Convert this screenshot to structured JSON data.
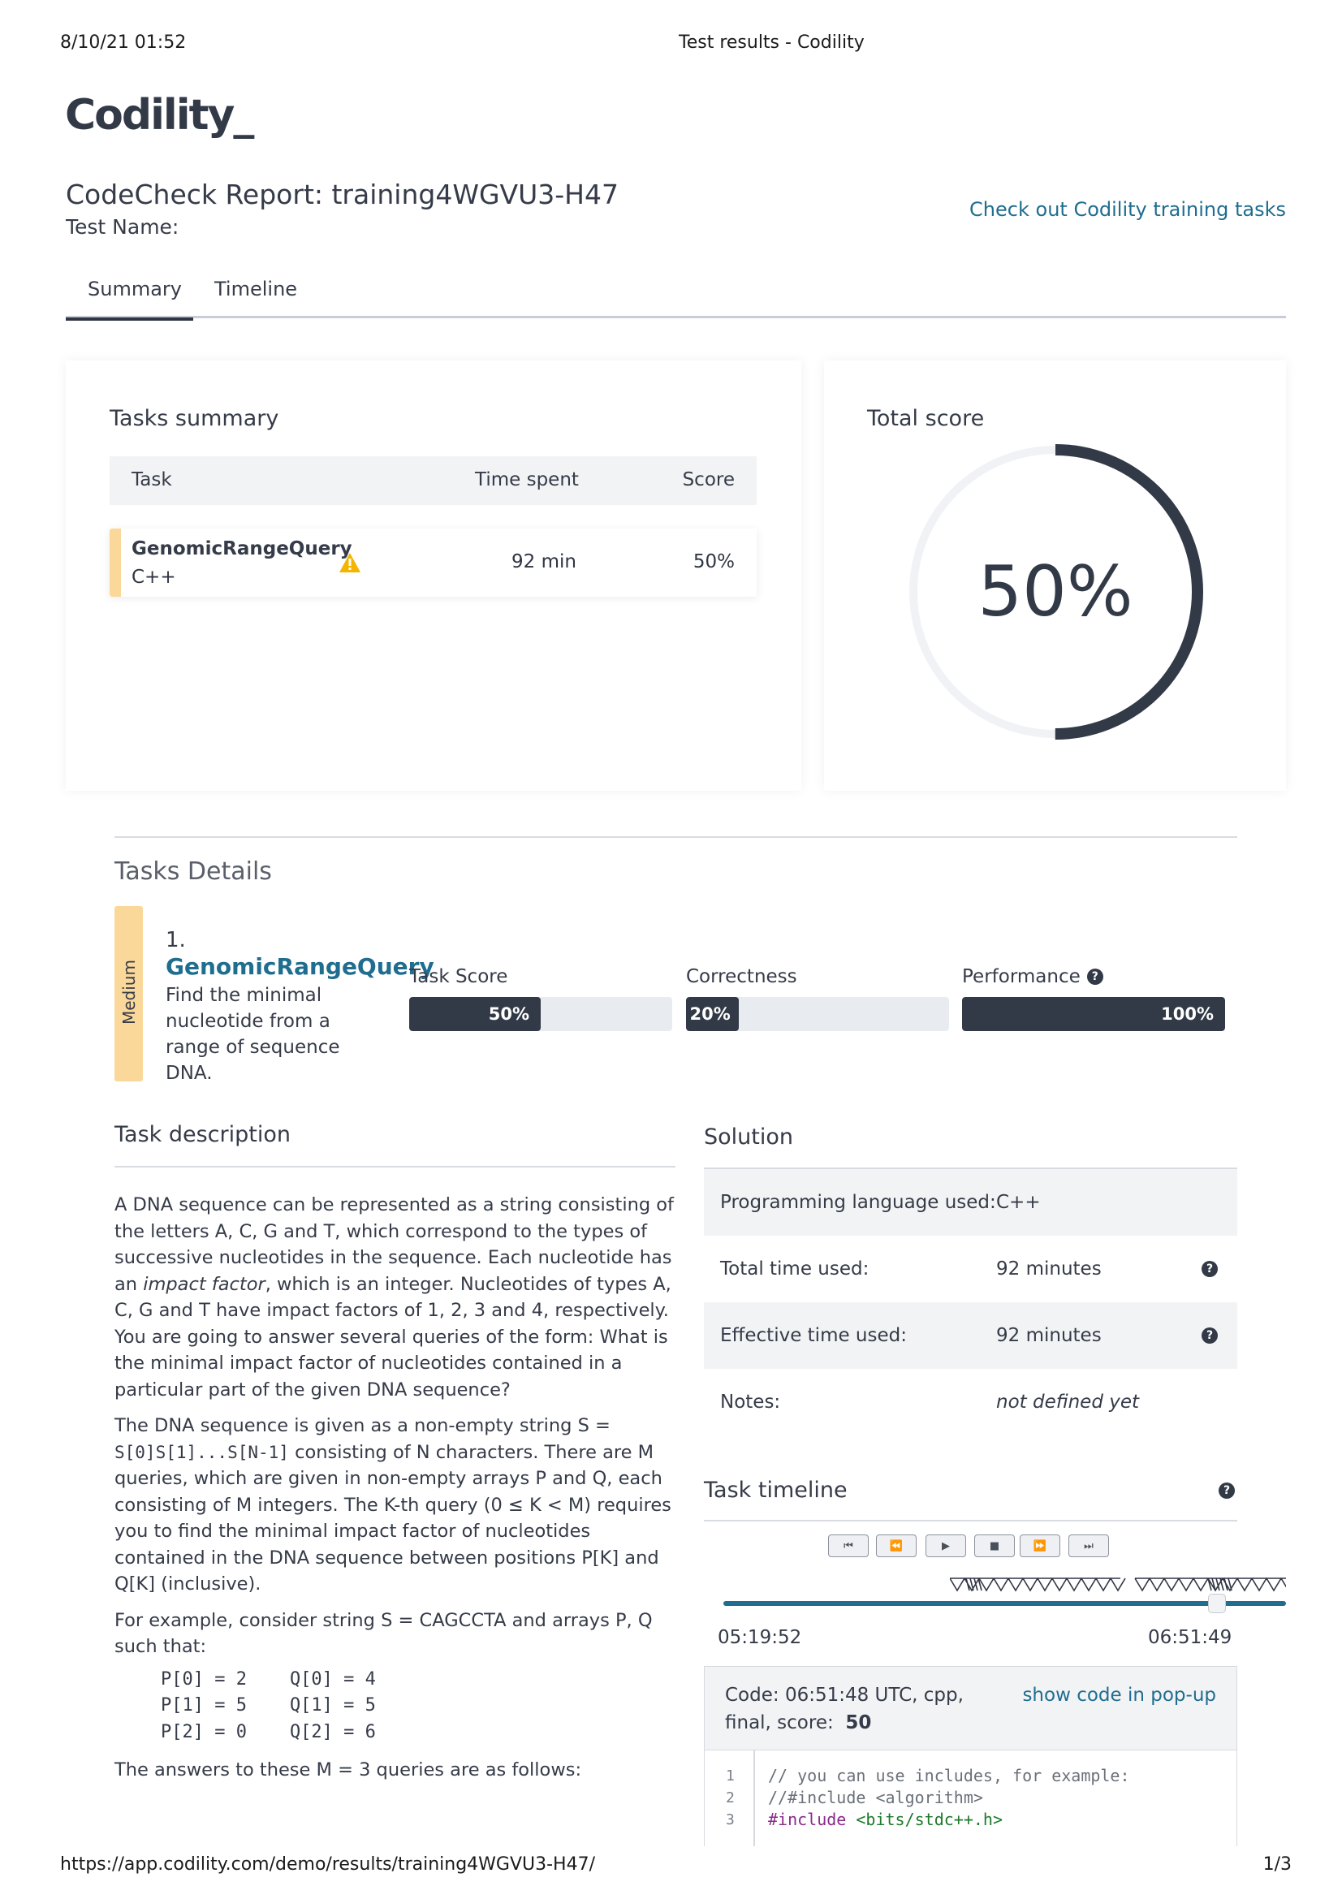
{
  "print_header": {
    "datetime": "8/10/21 01:52",
    "page_title": "Test results - Codility"
  },
  "brand": {
    "logo": "Codility_"
  },
  "report": {
    "title": "CodeCheck Report: training4WGVU3-H47",
    "test_name_label": "Test Name:",
    "training_link": "Check out Codility training tasks"
  },
  "tabs": [
    {
      "label": "Summary",
      "active": true
    },
    {
      "label": "Timeline",
      "active": false
    }
  ],
  "tasks_summary": {
    "title": "Tasks summary",
    "headers": {
      "task": "Task",
      "time": "Time spent",
      "score": "Score"
    },
    "rows": [
      {
        "name": "GenomicRangeQuery",
        "lang": "C++",
        "time": "92 min",
        "score": "50%",
        "warning": "warning-icon"
      }
    ]
  },
  "total_score": {
    "title": "Total score",
    "value": "50%",
    "fraction": 0.5
  },
  "tasks_details": {
    "title": "Tasks Details",
    "difficulty": "Medium",
    "number": "1.",
    "task_name": "GenomicRangeQuery",
    "task_summary": "Find the minimal nucleotide from a range of sequence DNA.",
    "metrics": [
      {
        "label": "Task Score",
        "value": "50%",
        "fraction": 0.5
      },
      {
        "label": "Correctness",
        "value": "20%",
        "fraction": 0.2
      },
      {
        "label": "Performance",
        "value": "100%",
        "fraction": 1.0
      }
    ]
  },
  "description": {
    "title": "Task description",
    "p1_a": "A DNA sequence can be represented as a string consisting of the letters A, C, G and T, which correspond to the types of successive nucleotides in the sequence. Each nucleotide has an ",
    "p1_em1": "impact factor",
    "p1_b": ", which is an integer. Nucleotides of types A, C, G and T have impact factors of 1, 2, 3 and 4, respectively. You are going to answer several queries of the form: What is the minimal impact factor of nucleotides contained in a particular part of the given DNA sequence?",
    "p2_a": "The DNA sequence is given as a non-empty string S = ",
    "p2_code": "S[0]S[1]...S[N-1]",
    "p2_b": " consisting of N characters. There are M queries, which are given in non-empty arrays P and Q, each consisting of M integers. The K-th query (0 ≤ K < M) requires you to find the minimal impact factor of nucleotides contained in the DNA sequence between positions P[K] and Q[K] (inclusive).",
    "p3": "For example, consider string S = CAGCCTA and arrays P, Q such that:",
    "example": [
      "P[0] = 2    Q[0] = 4",
      "P[1] = 5    Q[1] = 5",
      "P[2] = 0    Q[2] = 6"
    ],
    "p4": "The answers to these M = 3 queries are as follows:"
  },
  "solution": {
    "title": "Solution",
    "rows": [
      {
        "label": "Programming language used:",
        "value": "C++"
      },
      {
        "label": "Total time used:",
        "value": "92 minutes"
      },
      {
        "label": "Effective time used:",
        "value": "92 minutes"
      },
      {
        "label": "Notes:",
        "value": "not defined yet"
      }
    ]
  },
  "timeline": {
    "title": "Task timeline",
    "controls": [
      "⏮",
      "⏪",
      "▶",
      "■",
      "⏩",
      "⏭"
    ],
    "start": "05:19:52",
    "end": "06:51:49",
    "progress": 1.0
  },
  "code_panel": {
    "info_line1": "Code: 06:51:48 UTC, cpp,",
    "info_line2_label": "final, score:",
    "info_score": "50",
    "popup_link": "show code in pop-up",
    "lines": [
      {
        "n": "1",
        "text": "// you can use includes, for example:"
      },
      {
        "n": "2",
        "text": "//#include <algorithm>"
      },
      {
        "n": "3",
        "text_kw": "#include",
        "text_str": " <bits/stdc++.h>"
      }
    ]
  },
  "print_footer": {
    "url": "https://app.codility.com/demo/results/training4WGVU3-H47/",
    "page": "1/3"
  }
}
